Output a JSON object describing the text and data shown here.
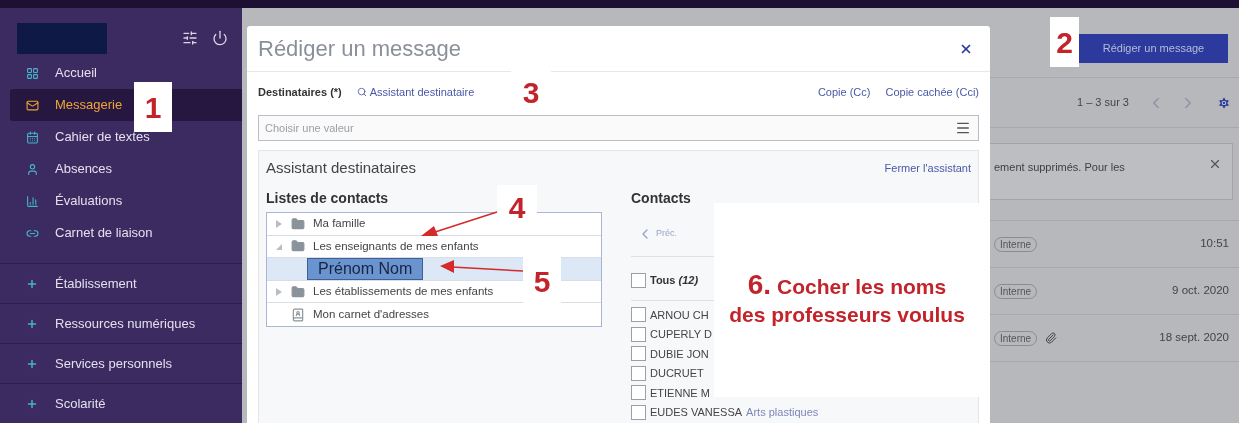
{
  "sidebar": {
    "items": [
      {
        "label": "Accueil",
        "selected": false
      },
      {
        "label": "Messagerie",
        "selected": true
      },
      {
        "label": "Cahier de textes",
        "selected": false
      },
      {
        "label": "Absences",
        "selected": false
      },
      {
        "label": "Évaluations",
        "selected": false
      },
      {
        "label": "Carnet de liaison",
        "selected": false
      }
    ],
    "sections": [
      {
        "label": "Établissement"
      },
      {
        "label": "Ressources numériques"
      },
      {
        "label": "Services personnels"
      },
      {
        "label": "Scolarité"
      }
    ]
  },
  "page": {
    "compose_button": "Rédiger un message",
    "pagination": "1 – 3 sur 3",
    "banner": "ement supprimés. Pour les",
    "messages": [
      {
        "tag": "Interne",
        "attachment": false,
        "date": "10:51"
      },
      {
        "tag": "Interne",
        "attachment": false,
        "date": "9 oct. 2020"
      },
      {
        "tag": "Interne",
        "attachment": true,
        "date": "18 sept. 2020"
      }
    ]
  },
  "dialog": {
    "title": "Rédiger un message",
    "recipients_label": "Destinataires (*)",
    "assistant_link": "Assistant destinataire",
    "cc": "Copie (Cc)",
    "bcc": "Copie cachée (Cci)",
    "recipients_placeholder": "Choisir une valeur",
    "assistant": {
      "title": "Assistant destinataires",
      "close": "Fermer l'assistant",
      "lists_heading": "Listes de contacts",
      "tree": [
        {
          "label": "Ma famille",
          "kind": "folder",
          "expanded": false,
          "selected": false
        },
        {
          "label": "Les enseignants de mes enfants",
          "kind": "folder",
          "expanded": true,
          "selected": false,
          "children": [
            {
              "label": "Prénom Nom",
              "kind": "person",
              "selected": true
            }
          ]
        },
        {
          "label": "Les établissements de mes enfants",
          "kind": "folder",
          "expanded": false,
          "selected": false
        },
        {
          "label": "Mon carnet d'adresses",
          "kind": "addressbook",
          "selected": false
        }
      ],
      "contacts_heading": "Contacts",
      "prev": "Préc.",
      "all": {
        "label": "Tous *(12)*",
        "checked": false
      },
      "contacts": [
        {
          "name": "ARNOU CH",
          "checked": false
        },
        {
          "name": "CUPERLY D",
          "checked": false
        },
        {
          "name": "DUBIE JON",
          "checked": false
        },
        {
          "name": "DUCRUET",
          "checked": false
        },
        {
          "name": "ETIENNE M",
          "checked": false
        },
        {
          "name": "EUDES VANESSA",
          "subject": "Arts plastiques",
          "checked": false
        }
      ]
    }
  },
  "annotations": [
    {
      "number": "1"
    },
    {
      "number": "2"
    },
    {
      "number": "3"
    },
    {
      "number": "4"
    },
    {
      "number": "5"
    },
    {
      "number": "6.",
      "text": "Cocher les noms des professeurs voulus"
    }
  ]
}
